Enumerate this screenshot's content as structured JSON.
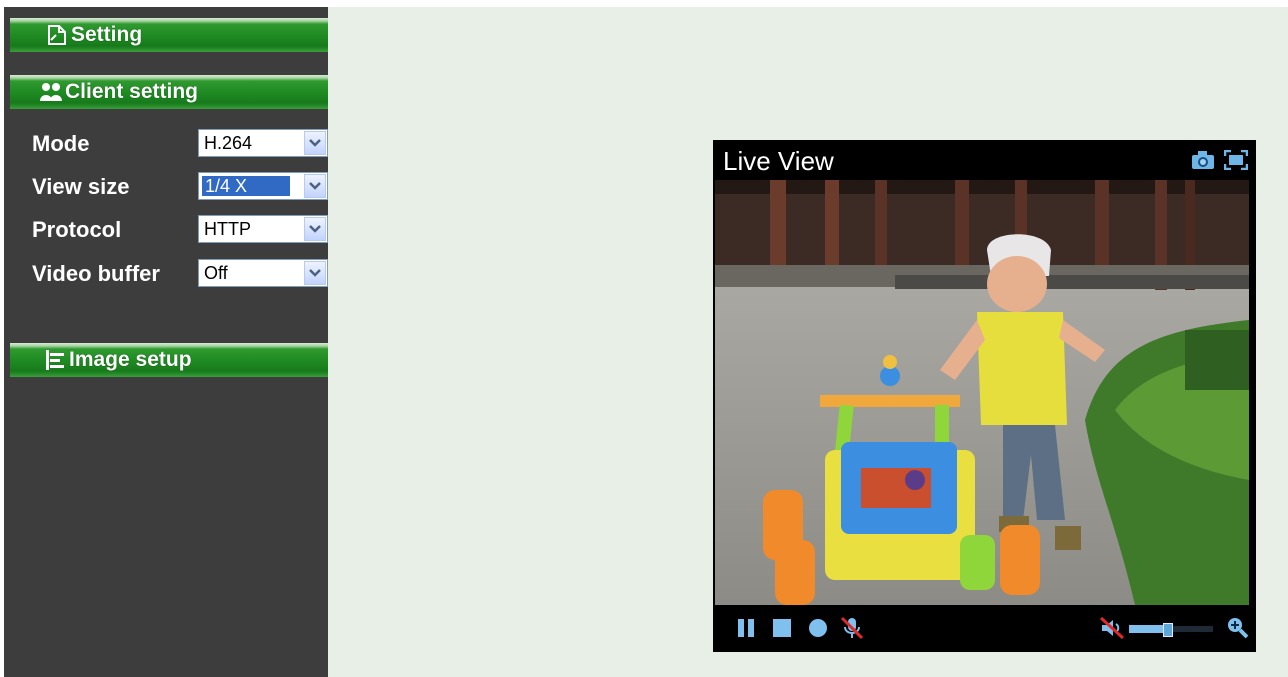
{
  "sidebar": {
    "setting": {
      "label": "Setting",
      "icon": "document-icon"
    },
    "client_setting": {
      "label": "Client setting",
      "icon": "users-icon"
    },
    "fields": [
      {
        "label": "Mode",
        "value": "H.264"
      },
      {
        "label": "View size",
        "value": "1/4 X"
      },
      {
        "label": "Protocol",
        "value": "HTTP"
      },
      {
        "label": "Video buffer",
        "value": "Off"
      }
    ],
    "image_setup": {
      "label": "Image setup",
      "icon": "sliders-icon"
    }
  },
  "live_view": {
    "title": "Live View",
    "top_icons": [
      "snapshot-camera-icon",
      "fullscreen-icon"
    ],
    "controls": [
      "pause-icon",
      "stop-icon",
      "record-icon",
      "microphone-muted-icon",
      "speaker-muted-icon",
      "volume-slider",
      "zoom-in-icon"
    ],
    "volume_level": 0.45
  },
  "colors": {
    "sidebar_bg": "#3d3d3d",
    "main_bg": "#e7efe7",
    "header_green": "#1f8a22",
    "accent_blue": "#2b8fd6"
  }
}
